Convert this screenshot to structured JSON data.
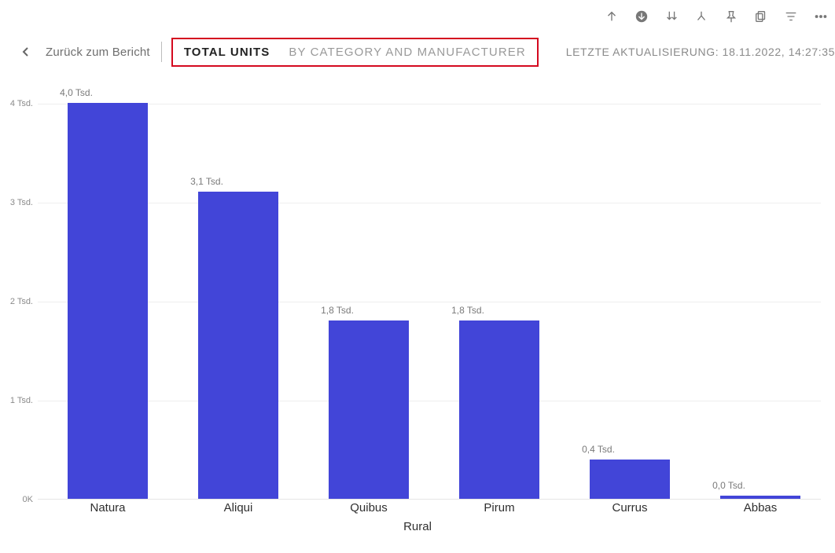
{
  "toolbar": {
    "icons": [
      "up-arrow-icon",
      "down-arrow-filled-icon",
      "double-down-icon",
      "branch-icon",
      "pin-icon",
      "copy-icon",
      "filter-icon",
      "more-icon"
    ]
  },
  "header": {
    "back_label": "Zurück zum Bericht",
    "tab_active": "TOTAL UNITS",
    "tab_other": "BY CATEGORY AND MANUFACTURER",
    "last_update": "LETZTE AKTUALISIERUNG: 18.11.2022, 14:27:35"
  },
  "chart_data": {
    "type": "bar",
    "categories": [
      "Natura",
      "Aliqui",
      "Quibus",
      "Pirum",
      "Currus",
      "Abbas"
    ],
    "values": [
      4000,
      3100,
      1800,
      1800,
      400,
      30
    ],
    "value_labels": [
      "4,0 Tsd.",
      "3,1 Tsd.",
      "1,8 Tsd.",
      "1,8 Tsd.",
      "0,4 Tsd.",
      "0,0 Tsd."
    ],
    "xlabel": "Rural",
    "ylabel": "",
    "ylim": [
      0,
      4000
    ],
    "y_ticks": [
      0,
      1000,
      2000,
      3000,
      4000
    ],
    "y_tick_labels": [
      "0K",
      "1 Tsd.",
      "2 Tsd.",
      "3 Tsd.",
      "4 Tsd."
    ],
    "bar_color": "#4245d8"
  }
}
